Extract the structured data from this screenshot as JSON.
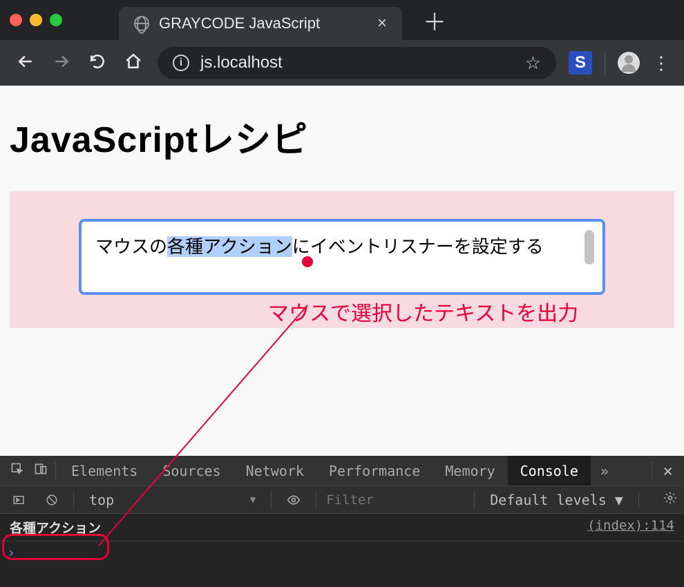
{
  "browser": {
    "tab_title": "GRAYCODE JavaScript",
    "url": "js.localhost",
    "new_tab_plus": "＋",
    "close_glyph": "×",
    "star_glyph": "☆",
    "kebab": "⋮",
    "ext_badge": "S"
  },
  "page": {
    "heading": "JavaScriptレシピ",
    "textarea_pre": "マウスの",
    "textarea_sel": "各種アクション",
    "textarea_post": "にイベントリスナーを設定する"
  },
  "annotation": {
    "label": "マウスで選択したテキストを出力"
  },
  "devtools": {
    "tabs": {
      "elements": "Elements",
      "sources": "Sources",
      "network": "Network",
      "performance": "Performance",
      "memory": "Memory",
      "console": "Console",
      "more": "»"
    },
    "filter": {
      "context": "top",
      "placeholder": "Filter",
      "levels": "Default levels ▼"
    },
    "log": {
      "message": "各種アクション",
      "source": "(index):114"
    },
    "prompt": "›"
  }
}
